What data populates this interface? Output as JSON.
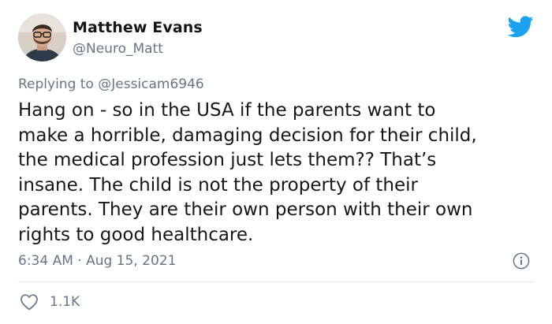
{
  "tweet": {
    "author": {
      "display_name": "Matthew Evans",
      "handle": "@Neuro_Matt"
    },
    "reply": {
      "prefix": "Replying to ",
      "mention": "@Jessicam6946"
    },
    "text": "Hang on - so in the USA if the parents want to\nmake a horrible, damaging decision for their child,\nthe medical profession just lets them?? That’s\ninsane. The child is not the property of their\nparents. They are their own person with their own\nrights to good healthcare.",
    "timestamp": "6:34 AM · Aug 15, 2021",
    "likes": "1.1K"
  },
  "icons": {
    "brand": "twitter-bird-icon",
    "info": "info-icon",
    "like": "heart-icon"
  },
  "colors": {
    "twitter_blue": "#1da1f2",
    "secondary_text": "#657786",
    "primary_text": "#14171a",
    "divider": "#e1e8ed"
  }
}
